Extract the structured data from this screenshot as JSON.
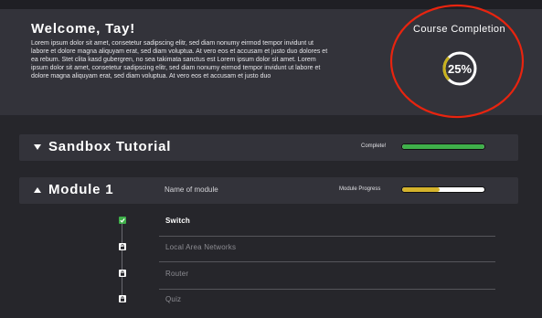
{
  "header": {
    "welcome": "Welcome, Tay!",
    "intro_text": "Lorem ipsum dolor sit amet, consetetur sadipscing elitr, sed diam nonumy eirmod tempor invidunt ut labore et dolore magna aliquyam erat, sed diam voluptua. At vero eos et accusam et justo duo dolores et ea rebum. Stet clita kasd gubergren, no sea takimata sanctus est Lorem ipsum dolor sit amet. Lorem ipsum dolor sit amet, consetetur sadipscing elitr, sed diam nonumy eirmod tempor invidunt ut labore et dolore magna aliquyam erat, sed diam voluptua. At vero eos et accusam et justo duo",
    "completion_label": "Course Completion",
    "completion_percent_text": "25%",
    "completion_fraction": 0.25
  },
  "sections": {
    "sandbox": {
      "title": "Sandbox Tutorial",
      "status_label": "Complete!",
      "progress_fraction": 1.0,
      "expanded": false
    },
    "module": {
      "title": "Module 1",
      "name": "Name of module",
      "progress_label": "Module Progress",
      "progress_fraction": 0.45,
      "expanded": true,
      "lessons": [
        {
          "label": "Switch",
          "state": "completed",
          "icon": "check-icon"
        },
        {
          "label": "Local Area Networks",
          "state": "unlocked",
          "icon": "unlock-icon"
        },
        {
          "label": "Router",
          "state": "locked",
          "icon": "lock-icon"
        },
        {
          "label": "Quiz",
          "state": "locked",
          "icon": "lock-icon"
        }
      ]
    }
  },
  "colors": {
    "background": "#26262b",
    "panel": "#33333a",
    "progress_green": "#3fb04a",
    "progress_yellow": "#d4b32c",
    "ring_track": "#ffffff",
    "ring_accent": "#c9b21c",
    "annotation_red": "#e8240f"
  }
}
